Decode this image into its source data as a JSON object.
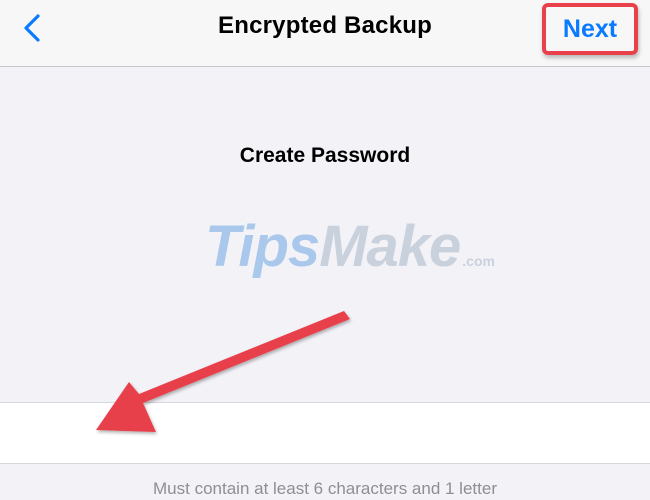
{
  "nav_bar": {
    "back_icon": "chevron-left-icon",
    "title": "Encrypted Backup",
    "next_label": "Next"
  },
  "content": {
    "section_title": "Create Password",
    "watermark": {
      "part1": "Tips",
      "part2": "Make",
      "suffix": ".com"
    }
  },
  "password_field": {
    "value": "",
    "placeholder": ""
  },
  "hint": "Must contain at least 6 characters and 1 letter",
  "colors": {
    "accent_blue": "#0a7aff",
    "highlight_red": "#e8414b",
    "background": "#f2f2f7"
  }
}
